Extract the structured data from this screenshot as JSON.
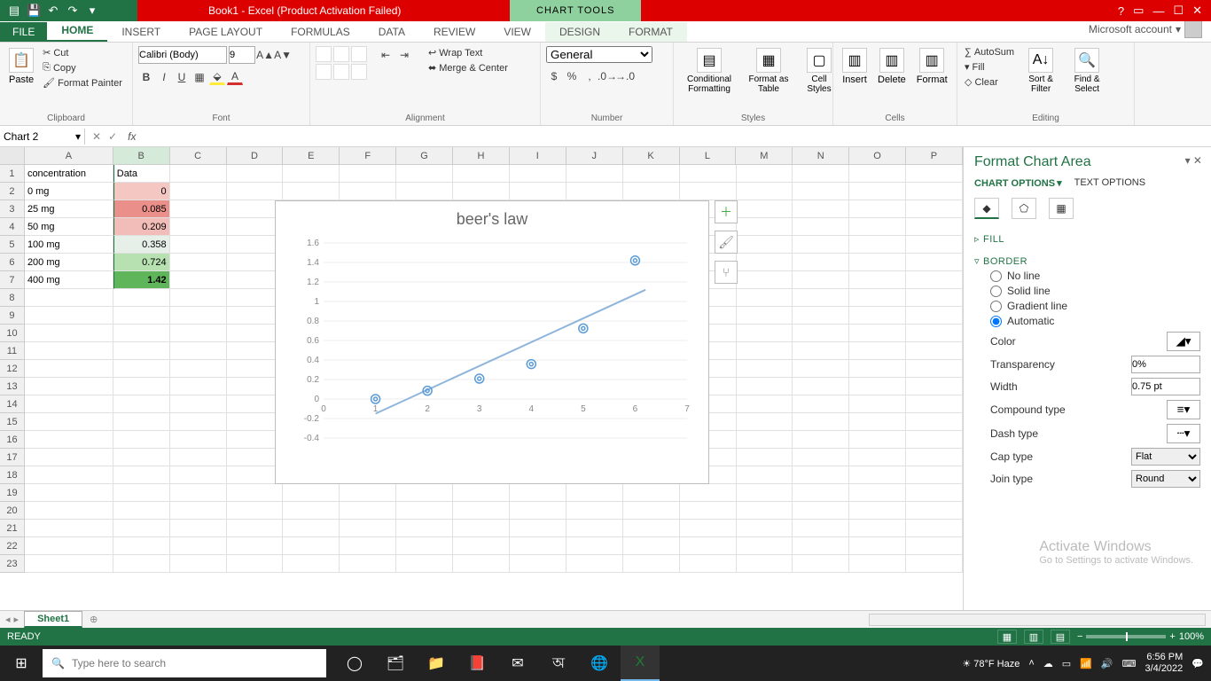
{
  "titlebar": {
    "title": "Book1 -  Excel (Product Activation Failed)",
    "chart_tools": "CHART TOOLS"
  },
  "tabs": {
    "file": "FILE",
    "items": [
      "HOME",
      "INSERT",
      "PAGE LAYOUT",
      "FORMULAS",
      "DATA",
      "REVIEW",
      "VIEW",
      "DESIGN",
      "FORMAT"
    ],
    "account": "Microsoft account"
  },
  "ribbon": {
    "clipboard": {
      "label": "Clipboard",
      "paste": "Paste",
      "cut": "Cut",
      "copy": "Copy",
      "fp": "Format Painter"
    },
    "font": {
      "label": "Font",
      "name": "Calibri (Body)",
      "size": "9"
    },
    "alignment": {
      "label": "Alignment",
      "wrap": "Wrap Text",
      "merge": "Merge & Center"
    },
    "number": {
      "label": "Number",
      "format": "General"
    },
    "styles": {
      "label": "Styles",
      "cf": "Conditional Formatting",
      "fat": "Format as Table",
      "cs": "Cell Styles"
    },
    "cells": {
      "label": "Cells",
      "ins": "Insert",
      "del": "Delete",
      "fmt": "Format"
    },
    "editing": {
      "label": "Editing",
      "sum": "AutoSum",
      "fill": "Fill",
      "clear": "Clear",
      "sort": "Sort & Filter",
      "find": "Find & Select"
    }
  },
  "namebox": "Chart 2",
  "sheet": {
    "headers": [
      "A",
      "B",
      "C",
      "D",
      "E",
      "F",
      "G",
      "H",
      "I",
      "J",
      "K",
      "L",
      "M",
      "N",
      "O",
      "P"
    ],
    "rows": [
      {
        "n": 1,
        "a": "concentration",
        "b": "Data"
      },
      {
        "n": 2,
        "a": "0 mg",
        "b": "0"
      },
      {
        "n": 3,
        "a": "25 mg",
        "b": "0.085"
      },
      {
        "n": 4,
        "a": "50 mg",
        "b": "0.209"
      },
      {
        "n": 5,
        "a": "100 mg",
        "b": "0.358"
      },
      {
        "n": 6,
        "a": "200 mg",
        "b": "0.724"
      },
      {
        "n": 7,
        "a": "400 mg",
        "b": "1.42"
      }
    ]
  },
  "chart_data": {
    "type": "scatter",
    "title": "beer's law",
    "x": [
      1,
      2,
      3,
      4,
      5,
      6
    ],
    "y": [
      0,
      0.085,
      0.209,
      0.358,
      0.724,
      1.42
    ],
    "xticks": [
      0,
      1,
      2,
      3,
      4,
      5,
      6,
      7
    ],
    "yticks": [
      -0.4,
      -0.2,
      0,
      0.2,
      0.4,
      0.6,
      0.8,
      1,
      1.2,
      1.4,
      1.6
    ],
    "ylim": [
      -0.4,
      1.6
    ],
    "xlim": [
      0,
      7
    ],
    "trendline": {
      "x1": 1,
      "y1": -0.15,
      "x2": 6.2,
      "y2": 1.12
    }
  },
  "fpane": {
    "title": "Format Chart Area",
    "tab1": "CHART OPTIONS",
    "tab2": "TEXT OPTIONS",
    "fill": "FILL",
    "border": "BORDER",
    "noline": "No line",
    "solid": "Solid line",
    "grad": "Gradient line",
    "auto": "Automatic",
    "color": "Color",
    "transp": "Transparency",
    "transp_v": "0%",
    "width": "Width",
    "width_v": "0.75 pt",
    "compound": "Compound type",
    "dash": "Dash type",
    "cap": "Cap type",
    "cap_v": "Flat",
    "join": "Join type",
    "join_v": "Round"
  },
  "watermark": {
    "l1": "Activate Windows",
    "l2": "Go to Settings to activate Windows."
  },
  "sheettab": "Sheet1",
  "status": {
    "ready": "READY",
    "zoom": "100%"
  },
  "taskbar": {
    "search": "Type here to search",
    "weather": "78°F Haze",
    "time": "6:56 PM",
    "date": "3/4/2022"
  }
}
